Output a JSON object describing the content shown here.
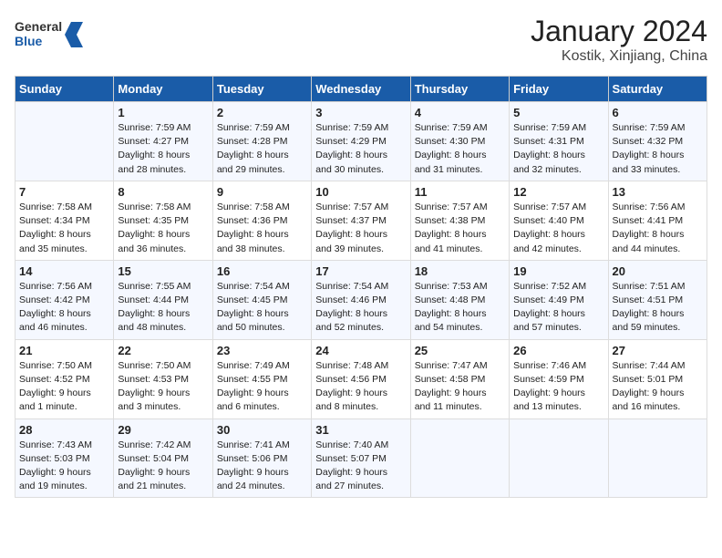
{
  "header": {
    "logo_line1": "General",
    "logo_line2": "Blue",
    "title": "January 2024",
    "subtitle": "Kostik, Xinjiang, China"
  },
  "weekdays": [
    "Sunday",
    "Monday",
    "Tuesday",
    "Wednesday",
    "Thursday",
    "Friday",
    "Saturday"
  ],
  "weeks": [
    [
      {
        "day": "",
        "info": ""
      },
      {
        "day": "1",
        "info": "Sunrise: 7:59 AM\nSunset: 4:27 PM\nDaylight: 8 hours\nand 28 minutes."
      },
      {
        "day": "2",
        "info": "Sunrise: 7:59 AM\nSunset: 4:28 PM\nDaylight: 8 hours\nand 29 minutes."
      },
      {
        "day": "3",
        "info": "Sunrise: 7:59 AM\nSunset: 4:29 PM\nDaylight: 8 hours\nand 30 minutes."
      },
      {
        "day": "4",
        "info": "Sunrise: 7:59 AM\nSunset: 4:30 PM\nDaylight: 8 hours\nand 31 minutes."
      },
      {
        "day": "5",
        "info": "Sunrise: 7:59 AM\nSunset: 4:31 PM\nDaylight: 8 hours\nand 32 minutes."
      },
      {
        "day": "6",
        "info": "Sunrise: 7:59 AM\nSunset: 4:32 PM\nDaylight: 8 hours\nand 33 minutes."
      }
    ],
    [
      {
        "day": "7",
        "info": "Sunrise: 7:58 AM\nSunset: 4:34 PM\nDaylight: 8 hours\nand 35 minutes."
      },
      {
        "day": "8",
        "info": "Sunrise: 7:58 AM\nSunset: 4:35 PM\nDaylight: 8 hours\nand 36 minutes."
      },
      {
        "day": "9",
        "info": "Sunrise: 7:58 AM\nSunset: 4:36 PM\nDaylight: 8 hours\nand 38 minutes."
      },
      {
        "day": "10",
        "info": "Sunrise: 7:57 AM\nSunset: 4:37 PM\nDaylight: 8 hours\nand 39 minutes."
      },
      {
        "day": "11",
        "info": "Sunrise: 7:57 AM\nSunset: 4:38 PM\nDaylight: 8 hours\nand 41 minutes."
      },
      {
        "day": "12",
        "info": "Sunrise: 7:57 AM\nSunset: 4:40 PM\nDaylight: 8 hours\nand 42 minutes."
      },
      {
        "day": "13",
        "info": "Sunrise: 7:56 AM\nSunset: 4:41 PM\nDaylight: 8 hours\nand 44 minutes."
      }
    ],
    [
      {
        "day": "14",
        "info": "Sunrise: 7:56 AM\nSunset: 4:42 PM\nDaylight: 8 hours\nand 46 minutes."
      },
      {
        "day": "15",
        "info": "Sunrise: 7:55 AM\nSunset: 4:44 PM\nDaylight: 8 hours\nand 48 minutes."
      },
      {
        "day": "16",
        "info": "Sunrise: 7:54 AM\nSunset: 4:45 PM\nDaylight: 8 hours\nand 50 minutes."
      },
      {
        "day": "17",
        "info": "Sunrise: 7:54 AM\nSunset: 4:46 PM\nDaylight: 8 hours\nand 52 minutes."
      },
      {
        "day": "18",
        "info": "Sunrise: 7:53 AM\nSunset: 4:48 PM\nDaylight: 8 hours\nand 54 minutes."
      },
      {
        "day": "19",
        "info": "Sunrise: 7:52 AM\nSunset: 4:49 PM\nDaylight: 8 hours\nand 57 minutes."
      },
      {
        "day": "20",
        "info": "Sunrise: 7:51 AM\nSunset: 4:51 PM\nDaylight: 8 hours\nand 59 minutes."
      }
    ],
    [
      {
        "day": "21",
        "info": "Sunrise: 7:50 AM\nSunset: 4:52 PM\nDaylight: 9 hours\nand 1 minute."
      },
      {
        "day": "22",
        "info": "Sunrise: 7:50 AM\nSunset: 4:53 PM\nDaylight: 9 hours\nand 3 minutes."
      },
      {
        "day": "23",
        "info": "Sunrise: 7:49 AM\nSunset: 4:55 PM\nDaylight: 9 hours\nand 6 minutes."
      },
      {
        "day": "24",
        "info": "Sunrise: 7:48 AM\nSunset: 4:56 PM\nDaylight: 9 hours\nand 8 minutes."
      },
      {
        "day": "25",
        "info": "Sunrise: 7:47 AM\nSunset: 4:58 PM\nDaylight: 9 hours\nand 11 minutes."
      },
      {
        "day": "26",
        "info": "Sunrise: 7:46 AM\nSunset: 4:59 PM\nDaylight: 9 hours\nand 13 minutes."
      },
      {
        "day": "27",
        "info": "Sunrise: 7:44 AM\nSunset: 5:01 PM\nDaylight: 9 hours\nand 16 minutes."
      }
    ],
    [
      {
        "day": "28",
        "info": "Sunrise: 7:43 AM\nSunset: 5:03 PM\nDaylight: 9 hours\nand 19 minutes."
      },
      {
        "day": "29",
        "info": "Sunrise: 7:42 AM\nSunset: 5:04 PM\nDaylight: 9 hours\nand 21 minutes."
      },
      {
        "day": "30",
        "info": "Sunrise: 7:41 AM\nSunset: 5:06 PM\nDaylight: 9 hours\nand 24 minutes."
      },
      {
        "day": "31",
        "info": "Sunrise: 7:40 AM\nSunset: 5:07 PM\nDaylight: 9 hours\nand 27 minutes."
      },
      {
        "day": "",
        "info": ""
      },
      {
        "day": "",
        "info": ""
      },
      {
        "day": "",
        "info": ""
      }
    ]
  ]
}
